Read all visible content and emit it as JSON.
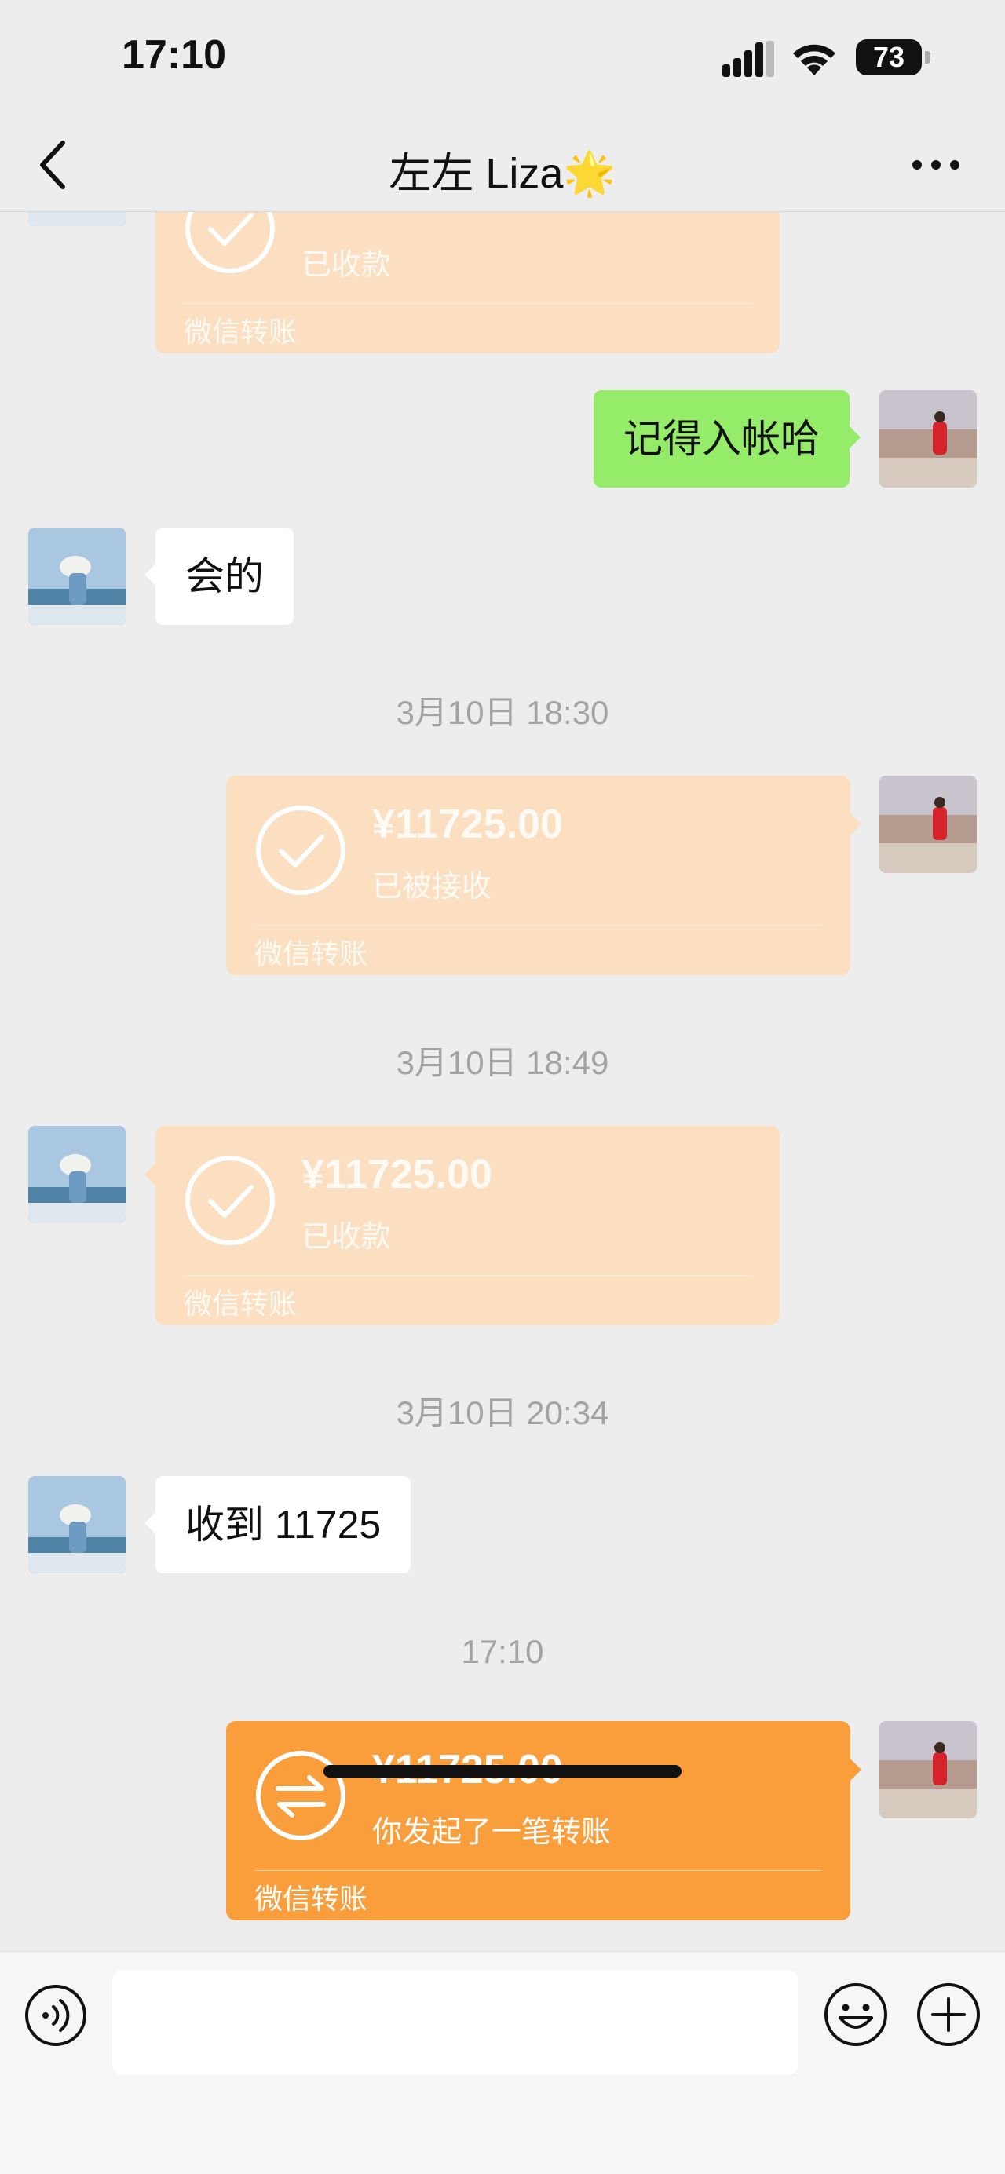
{
  "status_bar": {
    "time": "17:10",
    "battery": "73",
    "icons": [
      "signal-icon",
      "wifi-icon",
      "battery-icon"
    ]
  },
  "nav": {
    "title": "左左 Liza🌟",
    "back_icon": "chevron-left-icon",
    "more_icon": "more-icon"
  },
  "messages": [
    {
      "type": "transfer",
      "side": "left",
      "amount": "",
      "status": "已收款",
      "label": "微信转账",
      "state": "received"
    },
    {
      "type": "text",
      "side": "right",
      "text": "记得入帐哈"
    },
    {
      "type": "text",
      "side": "left",
      "text": "会的"
    },
    {
      "type": "timestamp",
      "text": "3月10日 18:30"
    },
    {
      "type": "transfer",
      "side": "right",
      "amount": "¥11725.00",
      "status": "已被接收",
      "label": "微信转账",
      "state": "accepted"
    },
    {
      "type": "timestamp",
      "text": "3月10日 18:49"
    },
    {
      "type": "transfer",
      "side": "left",
      "amount": "¥11725.00",
      "status": "已收款",
      "label": "微信转账",
      "state": "received"
    },
    {
      "type": "timestamp",
      "text": "3月10日 20:34"
    },
    {
      "type": "text",
      "side": "left",
      "text": "收到 11725"
    },
    {
      "type": "timestamp",
      "text": "17:10"
    },
    {
      "type": "transfer",
      "side": "right",
      "amount": "¥11725.00",
      "status": "你发起了一笔转账",
      "label": "微信转账",
      "state": "pending"
    }
  ],
  "input_bar": {
    "voice_icon": "voice-icon",
    "input_value": "",
    "emoji_icon": "emoji-icon",
    "plus_icon": "plus-icon"
  },
  "colors": {
    "background": "#ededed",
    "green_bubble": "#95ec69",
    "transfer_active": "#fa9d3b",
    "transfer_faded": "#fcdfc1"
  }
}
